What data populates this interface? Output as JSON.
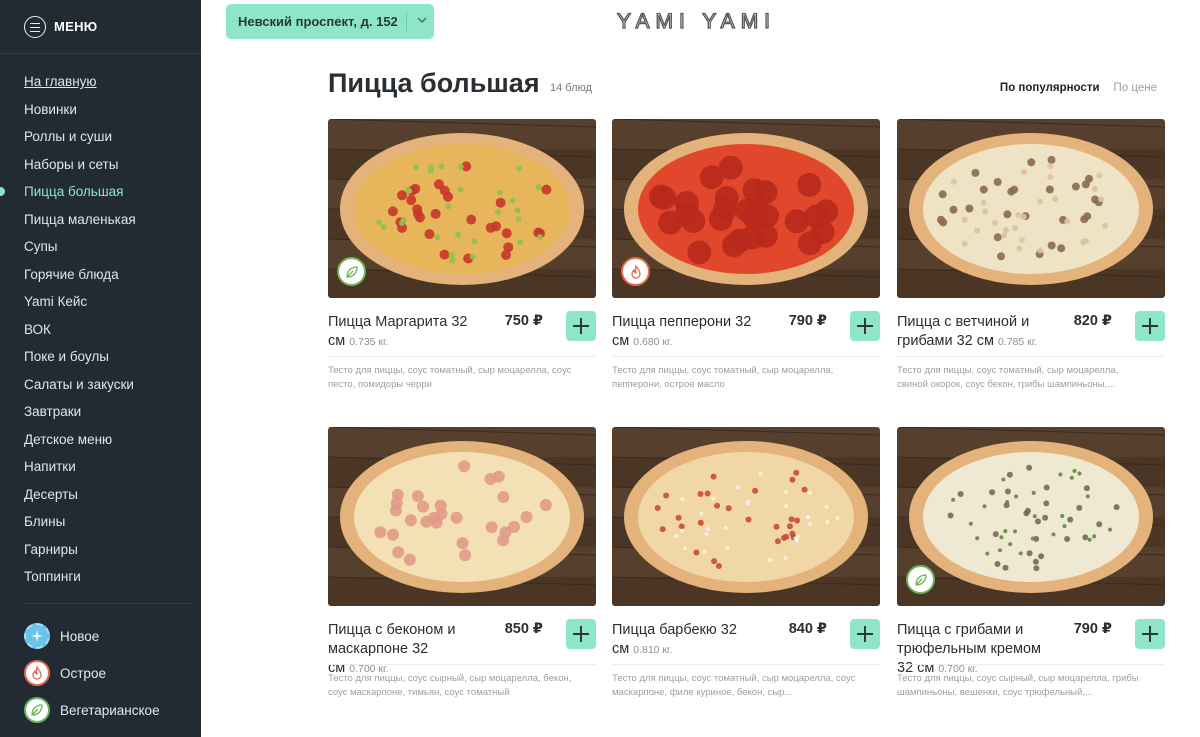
{
  "sidebar": {
    "title": "МЕНЮ",
    "items": [
      {
        "label": "На главную"
      },
      {
        "label": "Новинки"
      },
      {
        "label": "Роллы и суши"
      },
      {
        "label": "Наборы и сеты"
      },
      {
        "label": "Пицца большая",
        "active": true
      },
      {
        "label": "Пицца маленькая"
      },
      {
        "label": "Супы"
      },
      {
        "label": "Горячие блюда"
      },
      {
        "label": "Yami Кейс"
      },
      {
        "label": "ВОК"
      },
      {
        "label": "Поке и боулы"
      },
      {
        "label": "Салаты и закуски"
      },
      {
        "label": "Завтраки"
      },
      {
        "label": "Детское меню"
      },
      {
        "label": "Напитки"
      },
      {
        "label": "Десерты"
      },
      {
        "label": "Блины"
      },
      {
        "label": "Гарниры"
      },
      {
        "label": "Топпинги"
      }
    ],
    "legend": [
      {
        "label": "Новое",
        "icon": "new-icon"
      },
      {
        "label": "Острое",
        "icon": "spicy-icon"
      },
      {
        "label": "Вегетарианское",
        "icon": "leaf-icon"
      }
    ]
  },
  "header": {
    "address": "Невский проспект, д. 152",
    "logo": "YAMI YAMI"
  },
  "page": {
    "title": "Пицца большая",
    "count": "14 блюд",
    "sort": {
      "popular": "По популярности",
      "price": "По цене"
    }
  },
  "products": [
    {
      "name": "Пицца Маргарита 32 см",
      "weight": "0.735 кг.",
      "price": "750 ₽",
      "desc": "Тесто для пиццы, соус томатный, сыр моцарелла, соус песто, помидоры черри",
      "badge": "veg",
      "style": "margherita"
    },
    {
      "name": "Пицца пепперони 32 см",
      "weight": "0.680 кг.",
      "price": "790 ₽",
      "desc": "Тесто для пиццы, соус томатный, сыр моцарелла, пепперони, острое масло",
      "badge": "spicy",
      "style": "pepperoni"
    },
    {
      "name": "Пицца с ветчиной и грибами 32 см",
      "weight": "0.785 кг.",
      "price": "820 ₽",
      "desc": "Тесто для пиццы, соус томатный, сыр моцарелла, свиной окорок, соус бекон, грибы шампиньоны,...",
      "badge": "",
      "style": "ham"
    },
    {
      "name": "Пицца с беконом и маскарпоне 32 см",
      "weight": "0.700 кг.",
      "price": "850 ₽",
      "desc": "Тесто для пиццы, соус сырный, сыр моцарелла, бекон, соус маскарпоне, тимьян, соус томатный",
      "badge": "",
      "style": "bacon"
    },
    {
      "name": "Пицца барбекю 32 см",
      "weight": "0.810 кг.",
      "price": "840 ₽",
      "desc": "Тесто для пиццы, соус томатный, сыр моцарелла, соус маскарпоне, филе куриное, бекон, сыр...",
      "badge": "",
      "style": "bbq"
    },
    {
      "name": "Пицца с грибами и трюфельным кремом 32 см",
      "weight": "0.700 кг.",
      "price": "790 ₽",
      "desc": "Тесто для пиццы, соус сырный, сыр моцарелла, грибы шампиньоны, вешенки, соус трюфельный,...",
      "badge": "veg",
      "style": "mushroom"
    }
  ],
  "colors": {
    "accent": "#8ee6c6",
    "sidebar": "#222b33",
    "spicy": "#e36b4c",
    "veg": "#6bb45a"
  }
}
